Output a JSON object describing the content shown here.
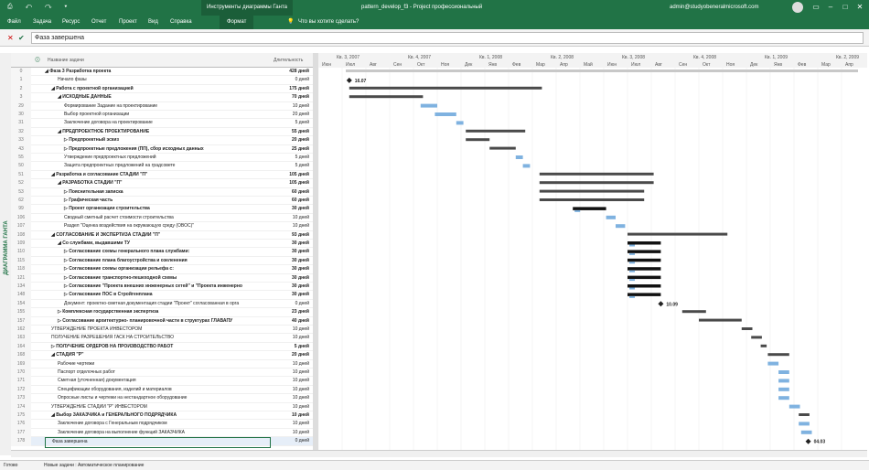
{
  "titlebar": {
    "context_tab": "Инструменты диаграммы Ганта",
    "title": "pattern_develop_f3  -  Project профессиональный",
    "account": "admin@studyobeneralmicrosoft.com",
    "quick_access": "⎙ ↶ ↷ ▾"
  },
  "ribbon": {
    "tabs": [
      "Файл",
      "Задача",
      "Ресурс",
      "Отчет",
      "Проект",
      "Вид",
      "Справка",
      "Формат"
    ],
    "tell_me": "Что вы хотите сделать?"
  },
  "formula_bar": {
    "value": "Фаза завершена"
  },
  "view_label": "ДИАГРАММА ГАНТА",
  "grid": {
    "col_name": "Название задачи",
    "col_dur": "Длительность",
    "rows": [
      {
        "id": "0",
        "name": "◢ Фаза 3 Разработка проекта",
        "dur": "428 дней",
        "ind": 0,
        "b": true
      },
      {
        "id": "1",
        "name": "Начало фазы",
        "dur": "0 дней",
        "ind": 2,
        "b": false
      },
      {
        "id": "2",
        "name": "◢ Работа с проектной организацией",
        "dur": "175 дней",
        "ind": 1,
        "b": true
      },
      {
        "id": "3",
        "name": "◢ ИСХОДНЫЕ ДАННЫЕ",
        "dur": "70 дней",
        "ind": 2,
        "b": true
      },
      {
        "id": "29",
        "name": "Формирование Задание на проектирование",
        "dur": "10 дней",
        "ind": 3,
        "b": false
      },
      {
        "id": "30",
        "name": "Выбор проектной организации",
        "dur": "20 дней",
        "ind": 3,
        "b": false
      },
      {
        "id": "31",
        "name": "Заключение договора на проектирование",
        "dur": "5 дней",
        "ind": 3,
        "b": false
      },
      {
        "id": "32",
        "name": "◢ ПРЕДПРОЕКТНОЕ ПРОЕКТИРОВАНИЕ",
        "dur": "55 дней",
        "ind": 2,
        "b": true
      },
      {
        "id": "33",
        "name": "▷ Предпроектный эскиз",
        "dur": "20 дней",
        "ind": 3,
        "b": true
      },
      {
        "id": "43",
        "name": "▷ Предпроектные предложения (ПП), сбор исходных данных",
        "dur": "25 дней",
        "ind": 3,
        "b": true
      },
      {
        "id": "55",
        "name": "Утверждение предпроектных предложений",
        "dur": "5 дней",
        "ind": 3,
        "b": false
      },
      {
        "id": "50",
        "name": "Защита предпроектных предложений на градсовете",
        "dur": "5 дней",
        "ind": 3,
        "b": false
      },
      {
        "id": "51",
        "name": "◢ Разработка и согласование СТАДИИ \"П\"",
        "dur": "105 дней",
        "ind": 1,
        "b": true
      },
      {
        "id": "52",
        "name": "◢ РАЗРАБОТКА СТАДИИ \"П\"",
        "dur": "105 дней",
        "ind": 2,
        "b": true
      },
      {
        "id": "53",
        "name": "▷ Пояснительная записка",
        "dur": "60 дней",
        "ind": 3,
        "b": true
      },
      {
        "id": "62",
        "name": "▷ Графическая часть",
        "dur": "60 дней",
        "ind": 3,
        "b": true
      },
      {
        "id": "99",
        "name": "▷ Проект организации строительства",
        "dur": "30 дней",
        "ind": 3,
        "b": true
      },
      {
        "id": "106",
        "name": "Сводный сметный расчет стоимости строительства",
        "dur": "10 дней",
        "ind": 3,
        "b": false
      },
      {
        "id": "107",
        "name": "Раздел \"Оценка воздействия на окружающую среду (ОВОС)\"",
        "dur": "10 дней",
        "ind": 3,
        "b": false
      },
      {
        "id": "108",
        "name": "◢ СОГЛАСОВАНИЕ И ЭКСПЕРТИЗА СТАДИИ \"П\"",
        "dur": "93 дней",
        "ind": 1,
        "b": true
      },
      {
        "id": "109",
        "name": "◢ Со службами, выдавшими ТУ",
        "dur": "30 дней",
        "ind": 2,
        "b": true
      },
      {
        "id": "110",
        "name": "▷ Согласование схемы генерального плана службами:",
        "dur": "30 дней",
        "ind": 3,
        "b": true
      },
      {
        "id": "115",
        "name": "▷ Согласование плана благоустройства и озеленения",
        "dur": "30 дней",
        "ind": 3,
        "b": true
      },
      {
        "id": "118",
        "name": "▷ Согласование схемы организации рельефа с:",
        "dur": "30 дней",
        "ind": 3,
        "b": true
      },
      {
        "id": "121",
        "name": "▷ Согласование транспортно-пешеходной схемы",
        "dur": "30 дней",
        "ind": 3,
        "b": true
      },
      {
        "id": "134",
        "name": "▷ Согласование \"Проекта внешних инженерных сетей\" и \"Проекта инженерно",
        "dur": "30 дней",
        "ind": 3,
        "b": true
      },
      {
        "id": "148",
        "name": "▷ Согласование ПОС в Стройгенплана",
        "dur": "30 дней",
        "ind": 3,
        "b": true
      },
      {
        "id": "154",
        "name": "Документ: проектно-сметная документация стадии \"Проект\" согласованная в орга",
        "dur": "0 дней",
        "ind": 3,
        "b": false
      },
      {
        "id": "155",
        "name": "▷ Комплексная государственная экспертиза",
        "dur": "23 дней",
        "ind": 2,
        "b": true
      },
      {
        "id": "157",
        "name": "▷ Согласование архитектурно- планировочной части в структурах ГЛАВАПУ",
        "dur": "40 дней",
        "ind": 2,
        "b": true
      },
      {
        "id": "162",
        "name": "УТВЕРЖДЕНИЕ ПРОЕКТА ИНВЕСТОРОМ",
        "dur": "10 дней",
        "ind": 1,
        "b": false
      },
      {
        "id": "163",
        "name": "ПОЛУЧЕНИЕ РАЗРЕШЕНИЯ ГАСК НА СТРОИТЕЛЬСТВО",
        "dur": "10 дней",
        "ind": 1,
        "b": false
      },
      {
        "id": "164",
        "name": "▷ ПОЛУЧЕНИЕ ОРДЕРОВ НА ПРОИЗВОДСТВО РАБОТ",
        "dur": "5 дней",
        "ind": 1,
        "b": true
      },
      {
        "id": "168",
        "name": "◢ СТАДИЯ \"Р\"",
        "dur": "20 дней",
        "ind": 1,
        "b": true
      },
      {
        "id": "169",
        "name": "Рабочие чертежи",
        "dur": "10 дней",
        "ind": 2,
        "b": false
      },
      {
        "id": "170",
        "name": "Паспорт отделочных работ",
        "dur": "10 дней",
        "ind": 2,
        "b": false
      },
      {
        "id": "171",
        "name": "Сметная (уточненная) документация",
        "dur": "10 дней",
        "ind": 2,
        "b": false
      },
      {
        "id": "172",
        "name": "Спецификации оборудования, изделий и материалов",
        "dur": "10 дней",
        "ind": 2,
        "b": false
      },
      {
        "id": "173",
        "name": "Опросные листы и чертежи на нестандартное оборудование",
        "dur": "10 дней",
        "ind": 2,
        "b": false
      },
      {
        "id": "174",
        "name": "УТВЕРЖДЕНИЕ СТАДИИ \"Р\" ИНВЕСТОРОМ",
        "dur": "10 дней",
        "ind": 1,
        "b": false
      },
      {
        "id": "175",
        "name": "◢ Выбор ЗАКАЗЧИКА  и ГЕНЕРАЛЬНОГО ПОДРЯДЧИКА",
        "dur": "10 дней",
        "ind": 1,
        "b": true
      },
      {
        "id": "176",
        "name": "Заключение договора с Генеральным подрядчиком",
        "dur": "10 дней",
        "ind": 2,
        "b": false
      },
      {
        "id": "177",
        "name": "Заключение договора на выполнение функций ЗАКАЗЧИКА",
        "dur": "10 дней",
        "ind": 2,
        "b": false
      },
      {
        "id": "178",
        "name": "Фаза завершена",
        "dur": "0 дней",
        "ind": 1,
        "b": false,
        "sel": true
      }
    ]
  },
  "timescale": {
    "quarters": [
      "Кв. 3, 2007",
      "Кв. 4, 2007",
      "Кв. 1, 2008",
      "Кв. 2, 2008",
      "Кв. 3, 2008",
      "Кв. 4, 2008",
      "Кв. 1, 2009",
      "Кв. 2, 2009"
    ],
    "months": [
      "Июн",
      "Июл",
      "Авг",
      "Сен",
      "Окт",
      "Ноя",
      "Дек",
      "Янв",
      "Фев",
      "Мар",
      "Апр",
      "Май",
      "Июн",
      "Июл",
      "Авг",
      "Сен",
      "Окт",
      "Ноя",
      "Дек",
      "Янв",
      "Фев",
      "Мар",
      "Апр"
    ]
  },
  "milestones": {
    "start": "16.07",
    "approval": "10.09",
    "end": "04.03"
  },
  "status": {
    "ready": "Готово",
    "mode": "Новые задачи : Автоматическое планирование"
  },
  "colors": {
    "accent": "#217346",
    "task": "#7fb2e0",
    "summary": "#4a4a4a"
  }
}
